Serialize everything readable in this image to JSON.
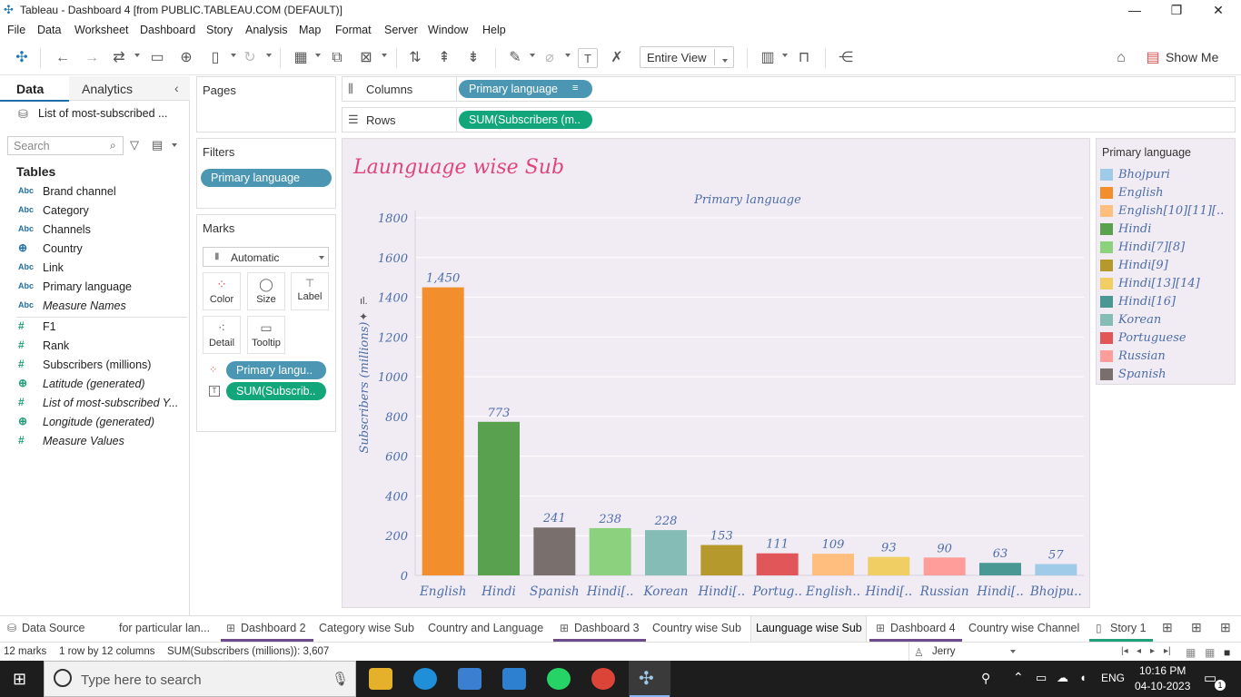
{
  "window": {
    "title": "Tableau - Dashboard 4 [from PUBLIC.TABLEAU.COM (DEFAULT)]"
  },
  "menu": [
    "File",
    "Data",
    "Worksheet",
    "Dashboard",
    "Story",
    "Analysis",
    "Map",
    "Format",
    "Server",
    "Window",
    "Help"
  ],
  "toolbar": {
    "fit_value": "Entire View",
    "show_me_label": "Show Me"
  },
  "data_pane": {
    "tabs": [
      "Data",
      "Analytics"
    ],
    "datasource": "List of most-subscribed ...",
    "search_placeholder": "Search",
    "tables_label": "Tables",
    "fields": [
      {
        "icon": "Abc",
        "name": "Brand channel"
      },
      {
        "icon": "Abc",
        "name": "Category"
      },
      {
        "icon": "Abc",
        "name": "Channels"
      },
      {
        "icon": "globe",
        "name": "Country"
      },
      {
        "icon": "Abc",
        "name": "Link"
      },
      {
        "icon": "Abc",
        "name": "Primary language"
      },
      {
        "icon": "Abc",
        "name": "Measure Names"
      },
      {
        "icon": "#",
        "name": "F1"
      },
      {
        "icon": "#",
        "name": "Rank"
      },
      {
        "icon": "#",
        "name": "Subscribers (millions)"
      },
      {
        "icon": "globe",
        "name": "Latitude (generated)"
      },
      {
        "icon": "#",
        "name": "List of most-subscribed Y..."
      },
      {
        "icon": "globe",
        "name": "Longitude (generated)"
      },
      {
        "icon": "#",
        "name": "Measure Values"
      }
    ]
  },
  "cards": {
    "pages_label": "Pages",
    "filters_label": "Filters",
    "filter_pill": "Primary language",
    "marks_label": "Marks",
    "mark_type": "Automatic",
    "mark_buttons": [
      "Color",
      "Size",
      "Label",
      "Detail",
      "Tooltip"
    ],
    "mark_pills": [
      "Primary langu..",
      "SUM(Subscrib.."
    ]
  },
  "shelves": {
    "columns_label": "Columns",
    "columns_pill": "Primary language",
    "rows_label": "Rows",
    "rows_pill": "SUM(Subscribers (m.."
  },
  "chart_data": {
    "type": "bar",
    "title": "Launguage wise Sub",
    "header": "Primary language",
    "ylabel": "Subscribers (millions)",
    "ylim": [
      0,
      1800
    ],
    "yticks": [
      0,
      200,
      400,
      600,
      800,
      1000,
      1200,
      1400,
      1600,
      1800
    ],
    "categories": [
      "English",
      "Hindi",
      "Spanish",
      "Hindi[..",
      "Korean",
      "Hindi[..",
      "Portug..",
      "English..",
      "Hindi[..",
      "Russian",
      "Hindi[..",
      "Bhojpu.."
    ],
    "values": [
      1450,
      773,
      241,
      238,
      228,
      153,
      111,
      109,
      93,
      90,
      63,
      57
    ],
    "data_labels": [
      "1,450",
      "773",
      "241",
      "238",
      "228",
      "153",
      "111",
      "109",
      "93",
      "90",
      "63",
      "57"
    ],
    "colors": [
      "#f28e2b",
      "#59a14f",
      "#79706e",
      "#8cd17d",
      "#86bcb6",
      "#b6992d",
      "#e15759",
      "#ffbe7d",
      "#f1ce63",
      "#ff9d9a",
      "#499894",
      "#a0cbe8"
    ]
  },
  "legend": {
    "title": "Primary language",
    "items": [
      {
        "label": "Bhojpuri",
        "color": "#a0cbe8"
      },
      {
        "label": "English",
        "color": "#f28e2b"
      },
      {
        "label": "English[10][11][..",
        "color": "#ffbe7d"
      },
      {
        "label": "Hindi",
        "color": "#59a14f"
      },
      {
        "label": "Hindi[7][8]",
        "color": "#8cd17d"
      },
      {
        "label": "Hindi[9]",
        "color": "#b6992d"
      },
      {
        "label": "Hindi[13][14]",
        "color": "#f1ce63"
      },
      {
        "label": "Hindi[16]",
        "color": "#499894"
      },
      {
        "label": "Korean",
        "color": "#86bcb6"
      },
      {
        "label": "Portuguese",
        "color": "#e15759"
      },
      {
        "label": "Russian",
        "color": "#ff9d9a"
      },
      {
        "label": "Spanish",
        "color": "#79706e"
      }
    ]
  },
  "sheet_tabs": [
    "Data Source",
    "for particular lan...",
    "Dashboard 2",
    "Category wise Sub",
    "Country and Language",
    "Dashboard 3",
    "Country wise Sub",
    "Launguage wise Sub",
    "Dashboard 4",
    "Country wise Channel",
    "Story 1"
  ],
  "status": {
    "marks": "12 marks",
    "dims": "1 row by 12 columns",
    "sum": "SUM(Subscribers (millions)): 3,607",
    "user": "Jerry"
  },
  "taskbar": {
    "search_placeholder": "Type here to search",
    "lang": "ENG",
    "time": "10:16 PM",
    "date": "04-10-2023",
    "notif_count": "1"
  }
}
